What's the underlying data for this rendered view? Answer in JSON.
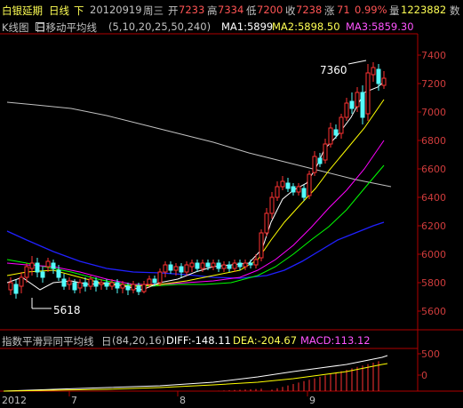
{
  "header": {
    "title": "白银延期",
    "period": "日线",
    "nav": "下",
    "date": "20120919",
    "weekday": "周三",
    "open_label": "开",
    "open": "7233",
    "high_label": "高",
    "high": "7334",
    "low_label": "低",
    "low": "7200",
    "close_label": "收",
    "close": "7238",
    "change_label": "涨",
    "change": "71",
    "change_pct": "0.99%",
    "volume_label": "量",
    "volume": "1223882",
    "last_label": "数"
  },
  "main_indicator": {
    "kline_label": "K线图",
    "ma_toggle": "日移动平均线",
    "ma_params": "(5,10,20,25,50,240)",
    "ma1": "MA1:5899",
    "ma2": "MA2:5898.50",
    "ma3": "MA3:5859.30"
  },
  "annotations": {
    "max_price": "7360",
    "min_price": "5618"
  },
  "price_axis": [
    "7400",
    "7200",
    "7000",
    "6800",
    "6600",
    "6400",
    "6200",
    "6000",
    "5800",
    "5600"
  ],
  "macd_indicator": {
    "name": "指数平滑异同平均线",
    "toggle": "日",
    "params": "(84,20,16)",
    "diff": "DIFF:-148.11",
    "dea": "DEA:-204.67",
    "macd": "MACD:113.12"
  },
  "macd_axis": [
    "500",
    "0"
  ],
  "time_axis": [
    "2012",
    "7",
    "8",
    "9"
  ],
  "colors": {
    "up": "#ff3232",
    "down": "#54fcfc",
    "ma_white": "#ffffff",
    "ma_yellow": "#ffff00",
    "ma_magenta": "#ff00ff",
    "ma_green": "#00ff00",
    "ma_blue": "#2020ff",
    "ma_gray": "#c0c0c0",
    "axis": "#b00000"
  }
}
